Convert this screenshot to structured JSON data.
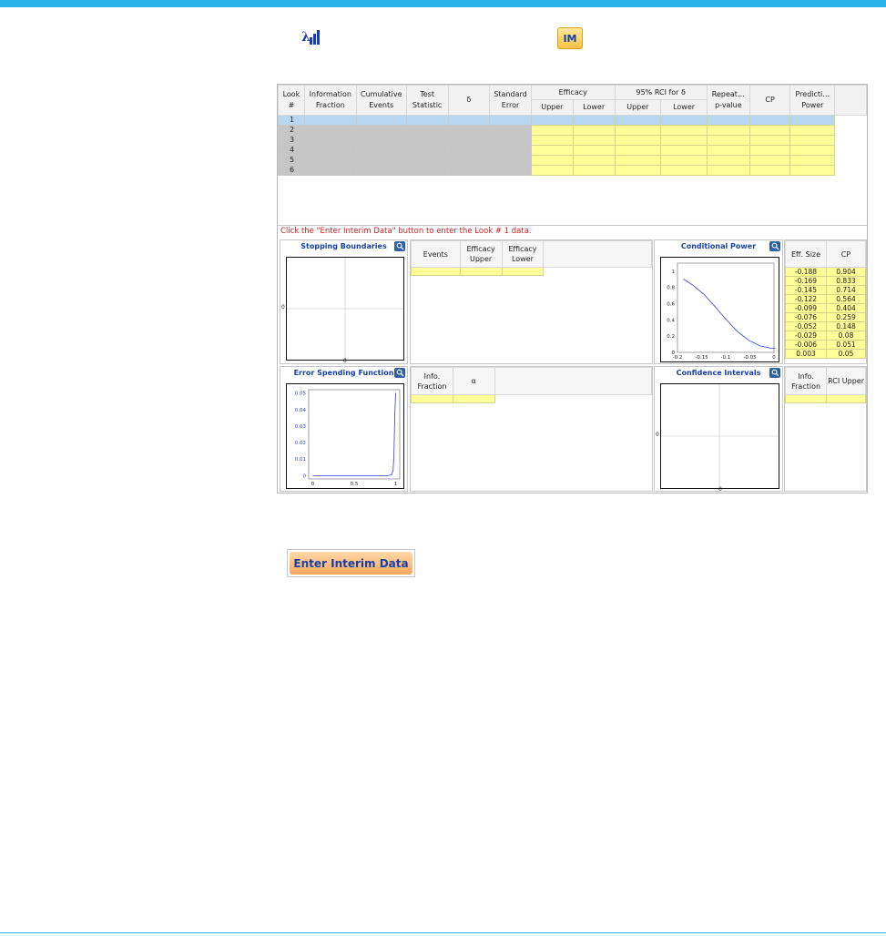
{
  "toolbar": {
    "lambda_icon": "lambda-chart-icon",
    "im_label": "IM"
  },
  "look_table": {
    "headers": {
      "look": "Look #",
      "info_fraction": "Information Fraction",
      "cum_events": "Cumulative Events",
      "test_stat": "Test Statistic",
      "delta": "δ",
      "std_err": "Standard Error",
      "efficacy": "Efficacy",
      "rci": "95% RCI for δ",
      "upper": "Upper",
      "lower": "Lower",
      "repeat_p": "Repeat… p-value",
      "cp": "CP",
      "pred_power": "Predicti… Power"
    },
    "rows": [
      "1",
      "2",
      "3",
      "4",
      "5",
      "6"
    ]
  },
  "status_message": "Click the \"Enter Interim Data\" button to enter the Look # 1 data.",
  "stopping_boundaries": {
    "title": "Stopping Boundaries",
    "y_tick": "0",
    "x_tick": "0",
    "table_headers": [
      "Events",
      "Efficacy Upper",
      "Efficacy Lower"
    ]
  },
  "conditional_power": {
    "title": "Conditional Power",
    "y_ticks": [
      "1",
      "0.8",
      "0.6",
      "0.4",
      "0.2",
      "0"
    ],
    "x_ticks": [
      "-0.2",
      "-0.15",
      "-0.1",
      "-0.05",
      "0"
    ],
    "table_headers": [
      "Eff. Size",
      "CP"
    ],
    "rows": [
      [
        "-0.188",
        "0.904"
      ],
      [
        "-0.169",
        "0.833"
      ],
      [
        "-0.145",
        "0.714"
      ],
      [
        "-0.122",
        "0.564"
      ],
      [
        "-0.099",
        "0.404"
      ],
      [
        "-0.076",
        "0.259"
      ],
      [
        "-0.052",
        "0.148"
      ],
      [
        "-0.029",
        "0.08"
      ],
      [
        "-0.006",
        "0.051"
      ],
      [
        "0.003",
        "0.05"
      ]
    ]
  },
  "error_spending": {
    "title": "Error Spending Function",
    "y_ticks": [
      "0.05",
      "0.04",
      "0.03",
      "0.02",
      "0.01",
      "0"
    ],
    "x_ticks": [
      "0",
      "0.5",
      "1"
    ],
    "table_headers": [
      "Info. Fraction",
      "α"
    ]
  },
  "confidence_intervals": {
    "title": "Confidence Intervals",
    "y_tick": "0",
    "x_tick": "0",
    "table_headers": [
      "Info. Fraction",
      "RCI Upper"
    ]
  },
  "enter_button_label": "Enter Interim Data",
  "chart_data": [
    {
      "type": "line",
      "title": "Conditional Power",
      "x": [
        -0.188,
        -0.169,
        -0.145,
        -0.122,
        -0.099,
        -0.076,
        -0.052,
        -0.029,
        -0.006,
        0.003
      ],
      "series": [
        {
          "values": [
            0.904,
            0.833,
            0.714,
            0.564,
            0.404,
            0.259,
            0.148,
            0.08,
            0.051,
            0.05
          ]
        }
      ],
      "xlim": [
        -0.2,
        0
      ],
      "ylim": [
        0,
        1.1
      ]
    },
    {
      "type": "line",
      "title": "Error Spending Function",
      "x": [
        0,
        0.5,
        0.9,
        0.95,
        0.97,
        0.98,
        0.99,
        1
      ],
      "series": [
        {
          "values": [
            0,
            0,
            0,
            0.0005,
            0.003,
            0.012,
            0.035,
            0.05
          ]
        }
      ],
      "xlim": [
        -0.05,
        1.05
      ],
      "ylim": [
        -0.002,
        0.052
      ]
    }
  ]
}
